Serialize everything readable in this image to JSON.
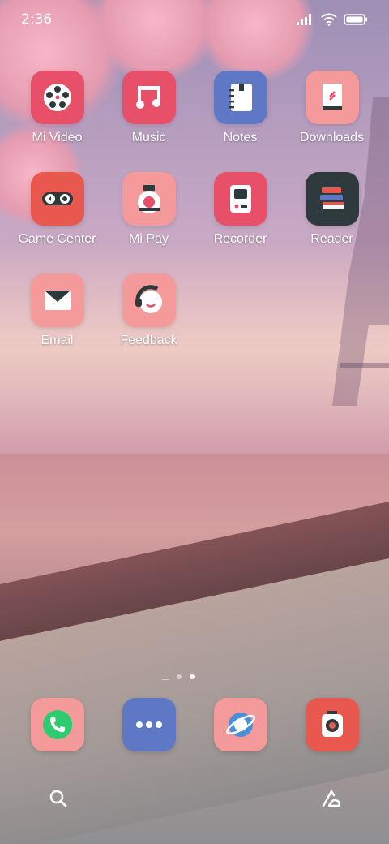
{
  "status_bar": {
    "time": "2:36"
  },
  "apps": [
    {
      "label": "Mi Video",
      "icon": "film-reel-icon",
      "color": "#e8506a"
    },
    {
      "label": "Music",
      "icon": "music-note-icon",
      "color": "#e8506a"
    },
    {
      "label": "Notes",
      "icon": "notebook-icon",
      "color": "#5e78c6"
    },
    {
      "label": "Downloads",
      "icon": "download-tray-icon",
      "color": "#f59a9a"
    },
    {
      "label": "Game Center",
      "icon": "gamepad-icon",
      "color": "#e8584e"
    },
    {
      "label": "Mi Pay",
      "icon": "wallet-icon",
      "color": "#f59a9a"
    },
    {
      "label": "Recorder",
      "icon": "recorder-icon",
      "color": "#e8506a"
    },
    {
      "label": "Reader",
      "icon": "books-icon",
      "color": "#2e3a3e"
    },
    {
      "label": "Email",
      "icon": "envelope-icon",
      "color": "#f59a9a"
    },
    {
      "label": "Feedback",
      "icon": "headset-icon",
      "color": "#f59a9a"
    }
  ],
  "dock": [
    {
      "icon": "phone-icon",
      "color": "#f59a9a"
    },
    {
      "icon": "messages-icon",
      "color": "#5e78c6"
    },
    {
      "icon": "browser-icon",
      "color": "#f59a9a"
    },
    {
      "icon": "camera-icon",
      "color": "#e8584e"
    }
  ]
}
